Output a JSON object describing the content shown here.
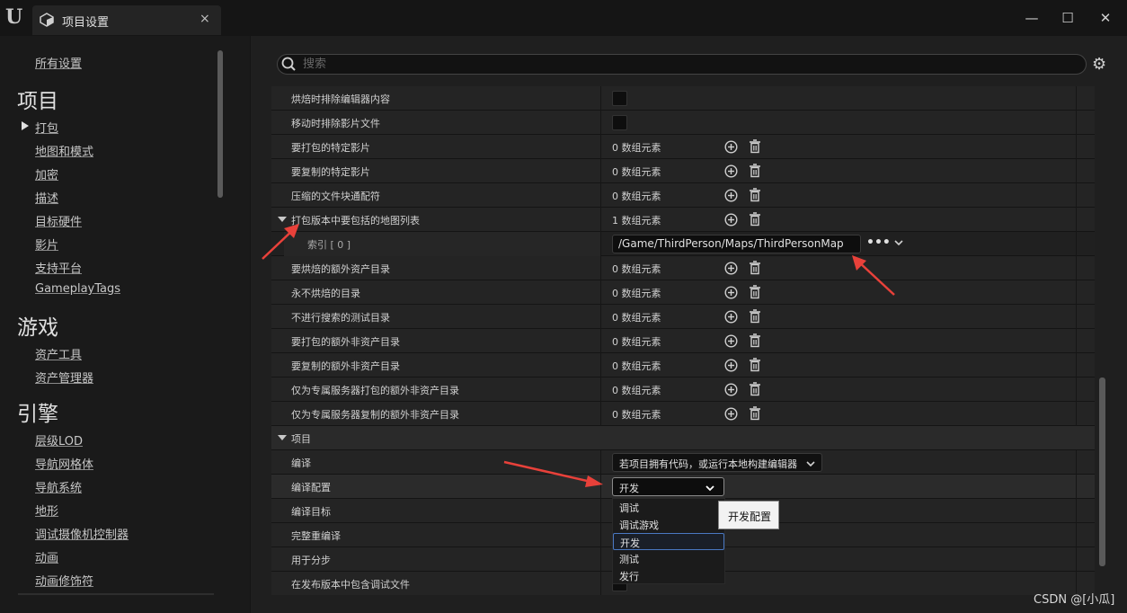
{
  "window": {
    "tab_title": "项目设置",
    "tab_close": "×",
    "minimize": "—",
    "maximize": "☐",
    "close": "✕"
  },
  "search": {
    "placeholder": "搜索"
  },
  "sidebar": {
    "all_settings": "所有设置",
    "sections": [
      {
        "heading": "项目",
        "items": [
          "打包",
          "地图和模式",
          "加密",
          "描述",
          "目标硬件",
          "影片",
          "支持平台",
          "GameplayTags"
        ]
      },
      {
        "heading": "游戏",
        "items": [
          "资产工具",
          "资产管理器"
        ]
      },
      {
        "heading": "引擎",
        "items": [
          "层级LOD",
          "导航网格体",
          "导航系统",
          "地形",
          "调试摄像机控制器",
          "动画",
          "动画修饰符"
        ]
      }
    ],
    "active_item": "打包"
  },
  "grid": {
    "rows": [
      {
        "label": "烘焙时排除编辑器内容",
        "type": "checkbox"
      },
      {
        "label": "移动时排除影片文件",
        "type": "checkbox"
      },
      {
        "label": "要打包的特定影片",
        "value": "0 数组元素",
        "type": "array"
      },
      {
        "label": "要复制的特定影片",
        "value": "0 数组元素",
        "type": "array"
      },
      {
        "label": "压缩的文件块通配符",
        "value": "0 数组元素",
        "type": "array"
      },
      {
        "label": "打包版本中要包括的地图列表",
        "value": "1 数组元素",
        "type": "array",
        "expanded": true
      },
      {
        "label": "索引 [ 0 ]",
        "value": "/Game/ThirdPerson/Maps/ThirdPersonMap",
        "type": "path"
      },
      {
        "label": "要烘焙的额外资产目录",
        "value": "0 数组元素",
        "type": "array"
      },
      {
        "label": "永不烘焙的目录",
        "value": "0 数组元素",
        "type": "array"
      },
      {
        "label": "不进行搜索的测试目录",
        "value": "0 数组元素",
        "type": "array"
      },
      {
        "label": "要打包的额外非资产目录",
        "value": "0 数组元素",
        "type": "array"
      },
      {
        "label": "要复制的额外非资产目录",
        "value": "0 数组元素",
        "type": "array"
      },
      {
        "label": "仅为专属服务器打包的额外非资产目录",
        "value": "0 数组元素",
        "type": "array"
      },
      {
        "label": "仅为专属服务器复制的额外非资产目录",
        "value": "0 数组元素",
        "type": "array"
      },
      {
        "label": "项目",
        "type": "category"
      },
      {
        "label": "编译",
        "value": "若项目拥有代码，或运行本地构建编辑器",
        "type": "combo"
      },
      {
        "label": "编译配置",
        "value": "开发",
        "type": "combo-open"
      },
      {
        "label": "编译目标",
        "type": "empty"
      },
      {
        "label": "完整重编译",
        "type": "empty"
      },
      {
        "label": "用于分步",
        "type": "empty"
      },
      {
        "label": "在发布版本中包含调试文件",
        "type": "checkbox"
      }
    ]
  },
  "dropdown": {
    "options": [
      "调试",
      "调试游戏",
      "开发",
      "测试",
      "发行"
    ],
    "selected": "开发",
    "tooltip": "开发配置"
  },
  "watermark": "CSDN @[小瓜]",
  "colors": {
    "annotation_arrow": "#e8413a",
    "selection_border": "#4a78c2"
  }
}
